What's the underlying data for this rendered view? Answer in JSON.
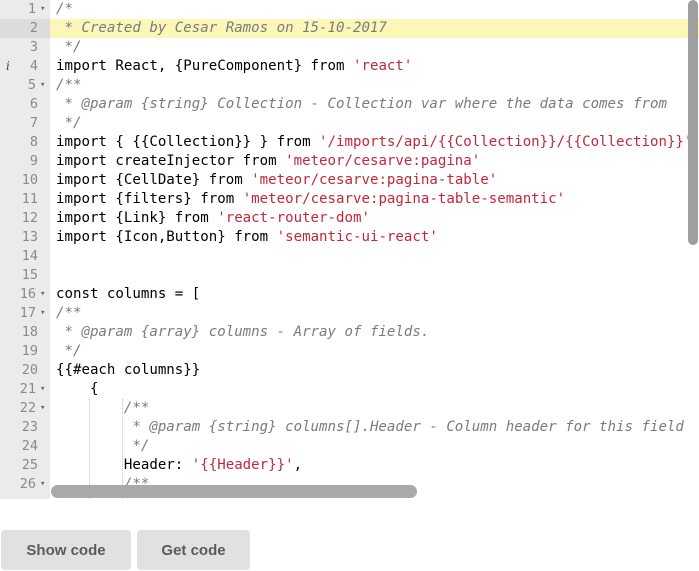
{
  "editor": {
    "lines": [
      {
        "n": "1",
        "fold": true,
        "tokens": [
          {
            "t": "/*",
            "k": "c"
          }
        ]
      },
      {
        "n": "2",
        "active": true,
        "tokens": [
          {
            "t": " * Created by Cesar Ramos on 15-10-2017",
            "k": "c"
          }
        ]
      },
      {
        "n": "3",
        "tokens": [
          {
            "t": " */",
            "k": "c"
          }
        ]
      },
      {
        "n": "4",
        "info": "i",
        "tokens": [
          {
            "t": "import React, {PureComponent} from "
          },
          {
            "t": "'react'",
            "k": "s"
          }
        ]
      },
      {
        "n": "5",
        "fold": true,
        "tokens": [
          {
            "t": "/**",
            "k": "c"
          }
        ]
      },
      {
        "n": "6",
        "tokens": [
          {
            "t": " * @param {string} Collection - Collection var where the data comes from",
            "k": "c"
          }
        ]
      },
      {
        "n": "7",
        "tokens": [
          {
            "t": " */",
            "k": "c"
          }
        ]
      },
      {
        "n": "8",
        "tokens": [
          {
            "t": "import { {{Collection}} } from "
          },
          {
            "t": "'/imports/api/{{Collection}}/{{Collection}}'",
            "k": "s"
          }
        ]
      },
      {
        "n": "9",
        "tokens": [
          {
            "t": "import createInjector from "
          },
          {
            "t": "'meteor/cesarve:pagina'",
            "k": "s"
          }
        ]
      },
      {
        "n": "10",
        "tokens": [
          {
            "t": "import {CellDate} from "
          },
          {
            "t": "'meteor/cesarve:pagina-table'",
            "k": "s"
          }
        ]
      },
      {
        "n": "11",
        "tokens": [
          {
            "t": "import {filters} from "
          },
          {
            "t": "'meteor/cesarve:pagina-table-semantic'",
            "k": "s"
          }
        ]
      },
      {
        "n": "12",
        "tokens": [
          {
            "t": "import {Link} from "
          },
          {
            "t": "'react-router-dom'",
            "k": "s"
          }
        ]
      },
      {
        "n": "13",
        "tokens": [
          {
            "t": "import {Icon,Button} from "
          },
          {
            "t": "'semantic-ui-react'",
            "k": "s"
          }
        ]
      },
      {
        "n": "14",
        "tokens": []
      },
      {
        "n": "15",
        "tokens": []
      },
      {
        "n": "16",
        "fold": true,
        "tokens": [
          {
            "t": "const columns = ["
          }
        ]
      },
      {
        "n": "17",
        "fold": true,
        "tokens": [
          {
            "t": "/**",
            "k": "c"
          }
        ]
      },
      {
        "n": "18",
        "tokens": [
          {
            "t": " * @param {array} columns - Array of fields.",
            "k": "c"
          }
        ]
      },
      {
        "n": "19",
        "tokens": [
          {
            "t": " */",
            "k": "c"
          }
        ]
      },
      {
        "n": "20",
        "tokens": [
          {
            "t": "{{#each columns}}"
          }
        ]
      },
      {
        "n": "21",
        "fold": true,
        "tokens": [
          {
            "t": "    {"
          }
        ]
      },
      {
        "n": "22",
        "fold": true,
        "tokens": [
          {
            "t": "        "
          },
          {
            "t": "/**",
            "k": "c"
          }
        ]
      },
      {
        "n": "23",
        "tokens": [
          {
            "t": "         * @param {string} columns[].Header - Column header for this field",
            "k": "c"
          }
        ]
      },
      {
        "n": "24",
        "tokens": [
          {
            "t": "         */",
            "k": "c"
          }
        ]
      },
      {
        "n": "25",
        "tokens": [
          {
            "t": "        Header: "
          },
          {
            "t": "'{{Header}}'",
            "k": "s"
          },
          {
            "t": ","
          }
        ]
      },
      {
        "n": "26",
        "fold": true,
        "tokens": [
          {
            "t": "        "
          },
          {
            "t": "/**",
            "k": "c"
          }
        ]
      }
    ],
    "fold_glyph": "▾"
  },
  "buttons": {
    "show_code": "Show code",
    "get_code": "Get code"
  },
  "colors": {
    "gutter_bg": "#ebebeb",
    "active_line_bg": "#fcf7b9",
    "comment": "#7b7b7b",
    "string": "#c3273b",
    "button_bg": "#e0e1e2"
  }
}
